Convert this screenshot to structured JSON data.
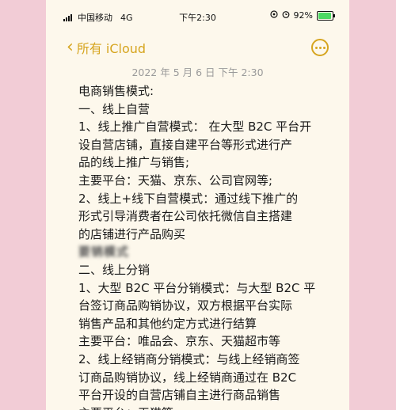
{
  "status_bar": {
    "carrier": "中国移动",
    "network": "4G",
    "time": "下午2:30",
    "battery_percent": "92%",
    "battery_level": 0.92,
    "status_icons": [
      "location-icon",
      "alarm-icon"
    ]
  },
  "nav": {
    "back_label": "所有 iCloud",
    "accent_color": "#d6a51f"
  },
  "note": {
    "date": "2022 年 5 月 6 日 下午 2:30",
    "lines": [
      "电商销售模式:",
      "一、线上自营",
      "1、线上推广自营模式： 在大型 B2C 平台开",
      "设自营店铺，直接自建平台等形式进行产",
      "品的线上推广与销售;",
      "主要平台：天猫、京东、公司官网等;",
      "2、线上+线下自营模式：通过线下推广的",
      "形式引导消费者在公司依托微信自主搭建",
      "的店铺进行产品购买",
      "要销模式",
      "二、线上分销",
      "1、大型 B2C 平台分销模式：与大型 B2C 平",
      "台签订商品购销协议，双方根据平台实际",
      "销售产品和其他约定方式进行结算",
      "主要平台：唯品会、京东、天猫超市等",
      "2、线上经销商分销模式：与线上经销商签",
      "订商品购销协议，线上经销商通过在 B2C",
      "平台开设的自营店铺自主进行商品销售",
      "主要平台：天猫等"
    ]
  }
}
